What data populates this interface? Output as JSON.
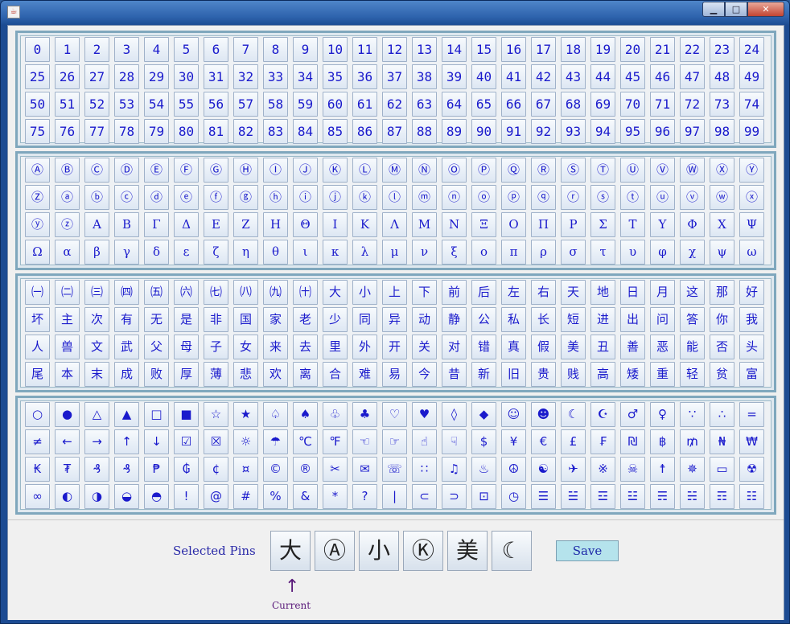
{
  "window": {
    "icon": "java-cup-icon",
    "buttons": {
      "minimize": "▁",
      "maximize": "□",
      "close": "✕"
    }
  },
  "panels": [
    {
      "name": "numbers",
      "style": "",
      "pins": [
        "0",
        "1",
        "2",
        "3",
        "4",
        "5",
        "6",
        "7",
        "8",
        "9",
        "10",
        "11",
        "12",
        "13",
        "14",
        "15",
        "16",
        "17",
        "18",
        "19",
        "20",
        "21",
        "22",
        "23",
        "24",
        "25",
        "26",
        "27",
        "28",
        "29",
        "30",
        "31",
        "32",
        "33",
        "34",
        "35",
        "36",
        "37",
        "38",
        "39",
        "40",
        "41",
        "42",
        "43",
        "44",
        "45",
        "46",
        "47",
        "48",
        "49",
        "50",
        "51",
        "52",
        "53",
        "54",
        "55",
        "56",
        "57",
        "58",
        "59",
        "60",
        "61",
        "62",
        "63",
        "64",
        "65",
        "66",
        "67",
        "68",
        "69",
        "70",
        "71",
        "72",
        "73",
        "74",
        "75",
        "76",
        "77",
        "78",
        "79",
        "80",
        "81",
        "82",
        "83",
        "84",
        "85",
        "86",
        "87",
        "88",
        "89",
        "90",
        "91",
        "92",
        "93",
        "94",
        "95",
        "96",
        "97",
        "98",
        "99"
      ]
    },
    {
      "name": "letters",
      "style": "serif",
      "pins": [
        "Ⓐ",
        "Ⓑ",
        "Ⓒ",
        "Ⓓ",
        "Ⓔ",
        "Ⓕ",
        "Ⓖ",
        "Ⓗ",
        "Ⓘ",
        "Ⓙ",
        "Ⓚ",
        "Ⓛ",
        "Ⓜ",
        "Ⓝ",
        "Ⓞ",
        "Ⓟ",
        "Ⓠ",
        "Ⓡ",
        "Ⓢ",
        "Ⓣ",
        "Ⓤ",
        "Ⓥ",
        "Ⓦ",
        "Ⓧ",
        "Ⓨ",
        "Ⓩ",
        "ⓐ",
        "ⓑ",
        "ⓒ",
        "ⓓ",
        "ⓔ",
        "ⓕ",
        "ⓖ",
        "ⓗ",
        "ⓘ",
        "ⓙ",
        "ⓚ",
        "ⓛ",
        "ⓜ",
        "ⓝ",
        "ⓞ",
        "ⓟ",
        "ⓠ",
        "ⓡ",
        "ⓢ",
        "ⓣ",
        "ⓤ",
        "ⓥ",
        "ⓦ",
        "ⓧ",
        "ⓨ",
        "ⓩ",
        "Α",
        "Β",
        "Γ",
        "Δ",
        "Ε",
        "Ζ",
        "Η",
        "Θ",
        "Ι",
        "Κ",
        "Λ",
        "Μ",
        "Ν",
        "Ξ",
        "Ο",
        "Π",
        "Ρ",
        "Σ",
        "Τ",
        "Υ",
        "Φ",
        "Χ",
        "Ψ",
        "Ω",
        "α",
        "β",
        "γ",
        "δ",
        "ε",
        "ζ",
        "η",
        "θ",
        "ι",
        "κ",
        "λ",
        "μ",
        "ν",
        "ξ",
        "ο",
        "π",
        "ρ",
        "σ",
        "τ",
        "υ",
        "φ",
        "χ",
        "ψ",
        "ω"
      ]
    },
    {
      "name": "chinese",
      "style": "sans",
      "pins": [
        "㈠",
        "㈡",
        "㈢",
        "㈣",
        "㈤",
        "㈥",
        "㈦",
        "㈧",
        "㈨",
        "㈩",
        "大",
        "小",
        "上",
        "下",
        "前",
        "后",
        "左",
        "右",
        "天",
        "地",
        "日",
        "月",
        "这",
        "那",
        "好",
        "坏",
        "主",
        "次",
        "有",
        "无",
        "是",
        "非",
        "国",
        "家",
        "老",
        "少",
        "同",
        "异",
        "动",
        "静",
        "公",
        "私",
        "长",
        "短",
        "进",
        "出",
        "问",
        "答",
        "你",
        "我",
        "人",
        "兽",
        "文",
        "武",
        "父",
        "母",
        "子",
        "女",
        "来",
        "去",
        "里",
        "外",
        "开",
        "关",
        "对",
        "错",
        "真",
        "假",
        "美",
        "丑",
        "善",
        "恶",
        "能",
        "否",
        "头",
        "尾",
        "本",
        "末",
        "成",
        "败",
        "厚",
        "薄",
        "悲",
        "欢",
        "离",
        "合",
        "难",
        "易",
        "今",
        "昔",
        "新",
        "旧",
        "贵",
        "贱",
        "高",
        "矮",
        "重",
        "轻",
        "贫",
        "富"
      ]
    },
    {
      "name": "symbols",
      "style": "sans",
      "pins": [
        "○",
        "●",
        "△",
        "▲",
        "□",
        "■",
        "☆",
        "★",
        "♤",
        "♠",
        "♧",
        "♣",
        "♡",
        "♥",
        "◊",
        "◆",
        "☺",
        "☻",
        "☾",
        "☪",
        "♂",
        "♀",
        "∵",
        "∴",
        "=",
        "≠",
        "←",
        "→",
        "↑",
        "↓",
        "☑",
        "☒",
        "☼",
        "☂",
        "℃",
        "℉",
        "☜",
        "☞",
        "☝",
        "☟",
        "$",
        "¥",
        "€",
        "£",
        "₣",
        "₪",
        "฿",
        "₥",
        "₦",
        "₩",
        "₭",
        "₮",
        "₰",
        "₰",
        "₱",
        "₲",
        "¢",
        "¤",
        "©",
        "®",
        "✂",
        "✉",
        "☏",
        "∷",
        "♫",
        "♨",
        "☮",
        "☯",
        "✈",
        "※",
        "☠",
        "☨",
        "✵",
        "▭",
        "☢",
        "∞",
        "◐",
        "◑",
        "◒",
        "◓",
        "!",
        "@",
        "#",
        "%",
        "&",
        "*",
        "?",
        "|",
        "⊂",
        "⊃",
        "⊡",
        "◷",
        "☰",
        "☱",
        "☲",
        "☳",
        "☴",
        "☵",
        "☶",
        "☷"
      ]
    }
  ],
  "bottom": {
    "selected_label": "Selected Pins",
    "selected_pins": [
      "大",
      "Ⓐ",
      "小",
      "Ⓚ",
      "美",
      "☾"
    ],
    "save_label": "Save",
    "current_arrow": "↑",
    "current_label": "Current"
  }
}
